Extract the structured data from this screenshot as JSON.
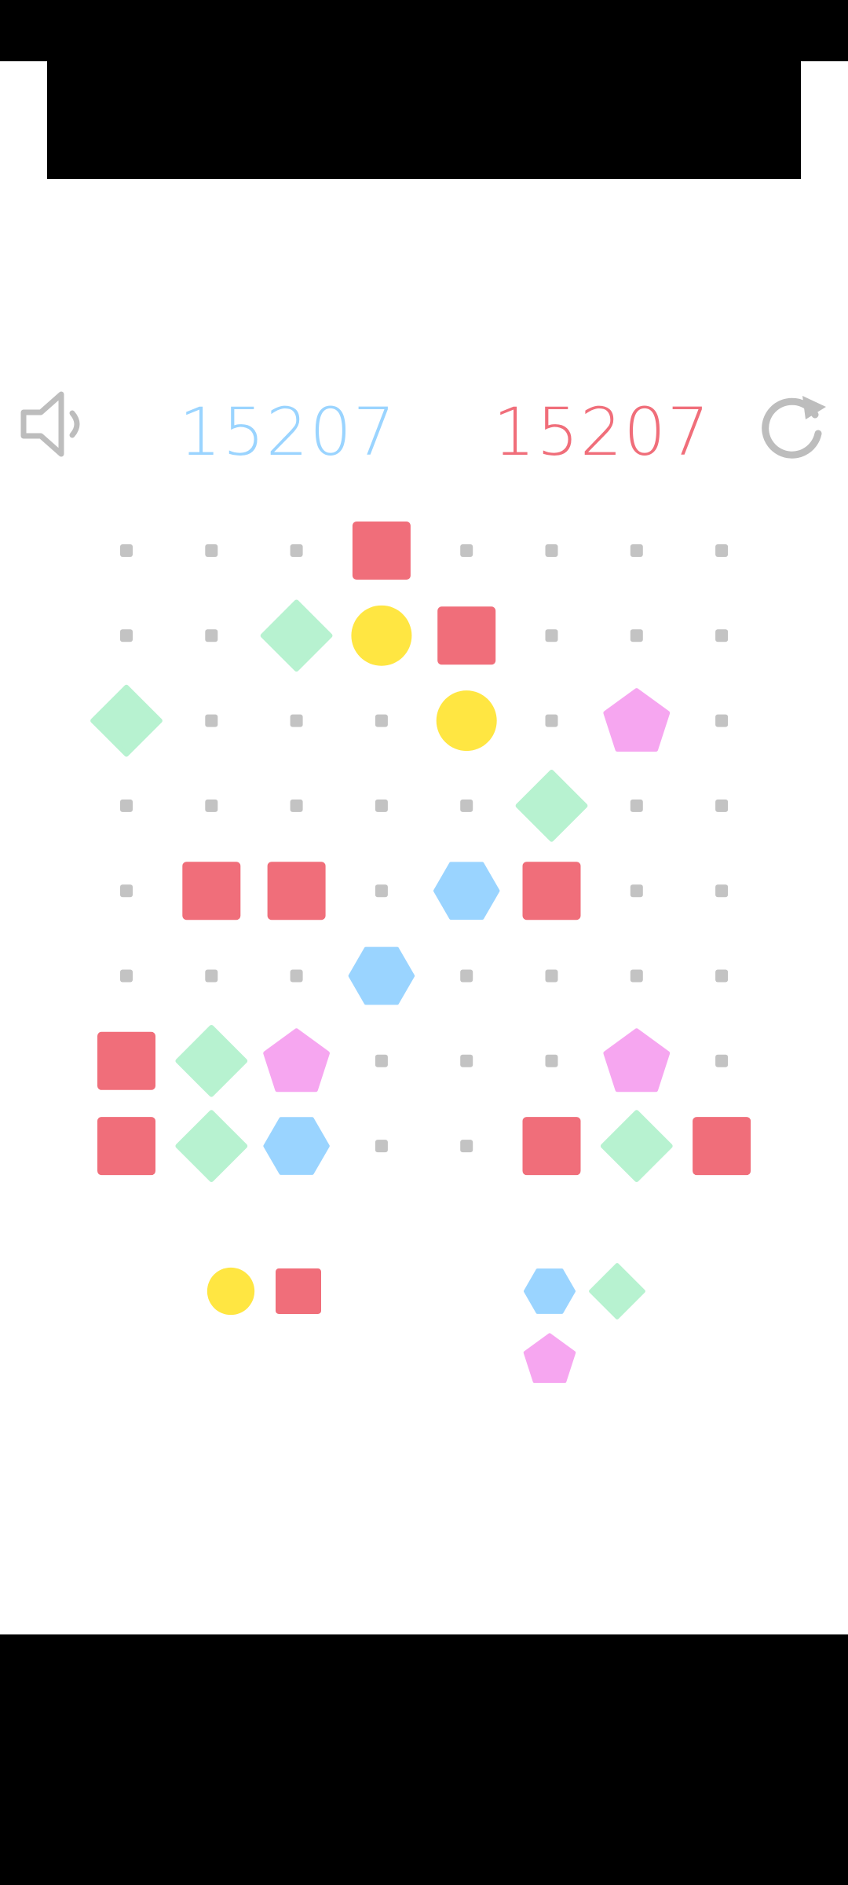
{
  "hud": {
    "current_score": "15207",
    "best_score": "15207",
    "sound_icon": "speaker-muted-icon",
    "restart_icon": "restart-icon"
  },
  "colors": {
    "square": "#f06e7a",
    "circle": "#ffe642",
    "diamond": "#b7f2d0",
    "pentagon": "#f6a6f0",
    "hexagon": "#9ad4ff",
    "dot": "#c3c3c3",
    "icon": "#bdbdbd",
    "current_score": "#9ad4ff",
    "best_score": "#f06e7a"
  },
  "board": {
    "cols": 8,
    "rows": 8,
    "grid": [
      [
        "empty",
        "empty",
        "empty",
        "square",
        "empty",
        "empty",
        "empty",
        "empty"
      ],
      [
        "empty",
        "empty",
        "diamond",
        "circle",
        "square",
        "empty",
        "empty",
        "empty"
      ],
      [
        "diamond",
        "empty",
        "empty",
        "empty",
        "circle",
        "empty",
        "pentagon",
        "empty"
      ],
      [
        "empty",
        "empty",
        "empty",
        "empty",
        "empty",
        "diamond",
        "empty",
        "empty"
      ],
      [
        "empty",
        "square",
        "square",
        "empty",
        "hexagon",
        "square",
        "empty",
        "empty"
      ],
      [
        "empty",
        "empty",
        "empty",
        "hexagon",
        "empty",
        "empty",
        "empty",
        "empty"
      ],
      [
        "square",
        "diamond",
        "pentagon",
        "empty",
        "empty",
        "empty",
        "pentagon",
        "empty"
      ],
      [
        "square",
        "diamond",
        "hexagon",
        "empty",
        "empty",
        "square",
        "diamond",
        "square"
      ]
    ]
  },
  "next_pieces": [
    {
      "shapes": [
        "circle",
        "square"
      ]
    },
    {
      "shapes": [
        "hexagon",
        "diamond",
        "pentagon"
      ]
    }
  ]
}
